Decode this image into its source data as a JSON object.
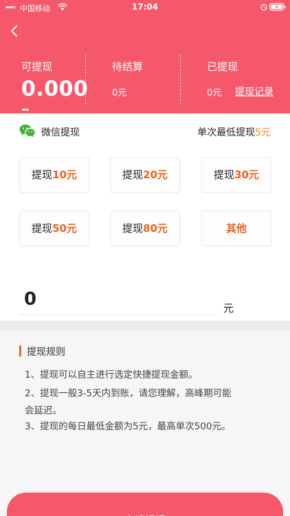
{
  "status_bar": {
    "carrier": "中国移动",
    "time": "17:04",
    "icons": [
      "signal-icon",
      "wifi-icon",
      "alarm-icon",
      "battery-charging-icon"
    ]
  },
  "header": {
    "back_icon": "chevron-left-icon",
    "withdrawable": {
      "label": "可提现",
      "value": "0.000"
    },
    "pending": {
      "label": "待结算",
      "value": "0元"
    },
    "withdrawn": {
      "label": "已提现",
      "value": "0元"
    },
    "record_link": "提现记录"
  },
  "wechat": {
    "icon": "wechat-icon",
    "label": "微信提现",
    "min_prefix": "单次最低提现",
    "min_value": "5元"
  },
  "options": [
    {
      "prefix": "提现",
      "amount": "10元"
    },
    {
      "prefix": "提现",
      "amount": "20元"
    },
    {
      "prefix": "提现",
      "amount": "30元"
    },
    {
      "prefix": "提现",
      "amount": "50元"
    },
    {
      "prefix": "提现",
      "amount": "80元"
    },
    {
      "prefix": "",
      "amount": "其他"
    }
  ],
  "amount_input": {
    "value": "0",
    "unit": "元"
  },
  "rules": {
    "title": "提现规则",
    "lines": [
      "1、提现可以自主进行选定快捷提现金额。",
      "2、提现一般3-5天内到账，请您理解，高峰期可能",
      "会延迟。",
      "3、提现的每日最低金额为5元，最高单次500元。"
    ]
  },
  "submit_label": "申请提现",
  "colors": {
    "primary": "#f5586a",
    "accent": "#e8661e",
    "min_highlight": "#f08a24"
  }
}
